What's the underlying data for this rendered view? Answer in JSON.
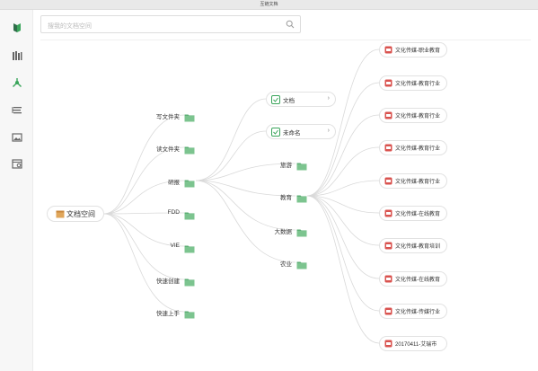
{
  "window": {
    "title": "互链文档"
  },
  "sidebar": {
    "icons": [
      "app-logo-icon",
      "library-icon",
      "mindmap-icon",
      "list-icon",
      "image-icon",
      "calendar-icon"
    ],
    "colors": {
      "logo_green": "#3aa55b",
      "logo_dark": "#2f6e4a",
      "active": "#3aa55b",
      "inactive": "#666666"
    }
  },
  "search": {
    "placeholder": "搜我的文档空间",
    "icon": "search-icon"
  },
  "tree": {
    "root": {
      "icon": "box-icon",
      "label": "文档空间"
    },
    "level1": [
      {
        "label": "写文件夹",
        "icon": "folder-icon"
      },
      {
        "label": "读文件夹",
        "icon": "folder-icon"
      },
      {
        "label": "研报",
        "icon": "folder-icon"
      },
      {
        "label": "FDD",
        "icon": "folder-icon"
      },
      {
        "label": "VIE",
        "icon": "folder-icon"
      },
      {
        "label": "快速创建",
        "icon": "folder-icon"
      },
      {
        "label": "快速上手",
        "icon": "folder-icon"
      }
    ],
    "level2_pills": [
      {
        "label": "文档",
        "icon": "mindmap-file-icon",
        "chevron": "›"
      },
      {
        "label": "未命名",
        "icon": "mindmap-file-icon",
        "chevron": "›"
      }
    ],
    "level2_folders": [
      {
        "label": "旅游",
        "icon": "folder-icon"
      },
      {
        "label": "教育",
        "icon": "folder-icon"
      },
      {
        "label": "大数据",
        "icon": "folder-icon"
      },
      {
        "label": "农业",
        "icon": "folder-icon"
      }
    ],
    "level3_docs": [
      {
        "label": "文化传媒-职业教育",
        "icon": "pdf-icon"
      },
      {
        "label": "文化传媒-教育行业",
        "icon": "pdf-icon"
      },
      {
        "label": "文化传媒-教育行业",
        "icon": "pdf-icon"
      },
      {
        "label": "文化传媒-教育行业",
        "icon": "pdf-icon"
      },
      {
        "label": "文化传媒-教育行业",
        "icon": "pdf-icon"
      },
      {
        "label": "文化传媒-在线教育",
        "icon": "pdf-icon"
      },
      {
        "label": "文化传媒-教育培训",
        "icon": "pdf-icon"
      },
      {
        "label": "文化传媒-在线教育",
        "icon": "pdf-icon"
      },
      {
        "label": "文化传媒-传媒行业",
        "icon": "pdf-icon"
      },
      {
        "label": "20170411-艾瑞市",
        "icon": "pdf-icon"
      }
    ],
    "colors": {
      "folder": "#7cc48f",
      "folder_dark": "#5daf75",
      "line": "#d9d9d9",
      "pdf": "#d9534f"
    }
  }
}
